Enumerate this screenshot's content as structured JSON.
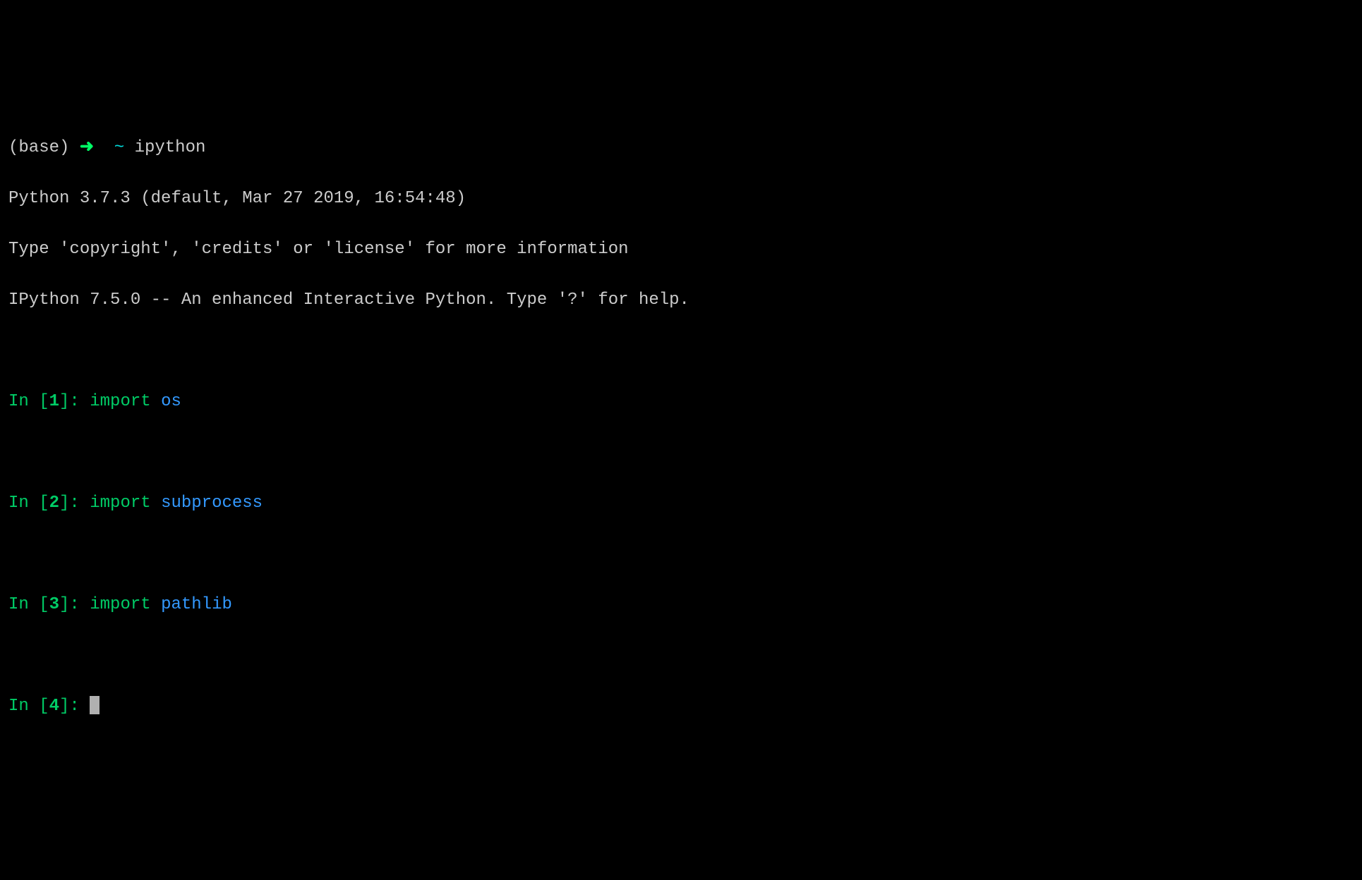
{
  "shell": {
    "env": "(base)",
    "arrow": "➜",
    "tilde": "~",
    "command": "ipython"
  },
  "header": {
    "line1": "Python 3.7.3 (default, Mar 27 2019, 16:54:48)",
    "line2": "Type 'copyright', 'credits' or 'license' for more information",
    "line3": "IPython 7.5.0 -- An enhanced Interactive Python. Type '?' for help."
  },
  "cells": [
    {
      "in_label": "In [",
      "num": "1",
      "close": "]: ",
      "kw": "import ",
      "mod": "os"
    },
    {
      "in_label": "In [",
      "num": "2",
      "close": "]: ",
      "kw": "import ",
      "mod": "subprocess"
    },
    {
      "in_label": "In [",
      "num": "3",
      "close": "]: ",
      "kw": "import ",
      "mod": "pathlib"
    }
  ],
  "current": {
    "in_label": "In [",
    "num": "4",
    "close": "]: "
  }
}
